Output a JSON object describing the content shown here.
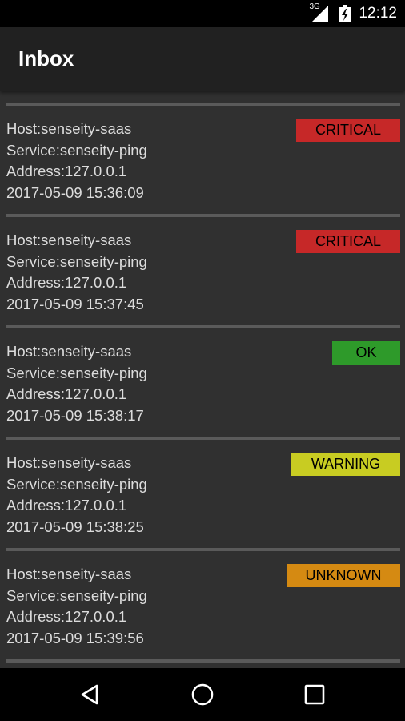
{
  "status_bar": {
    "network_label": "3G",
    "time": "12:12",
    "icons": [
      "signal-icon",
      "battery-charging-icon"
    ]
  },
  "app_bar": {
    "title": "Inbox"
  },
  "alerts": [
    {
      "host": "Host:senseity-saas",
      "service": "Service:senseity-ping",
      "address": "Address:127.0.0.1",
      "timestamp": "2017-05-09 15:36:09",
      "status": "CRITICAL",
      "status_color": "#c62828"
    },
    {
      "host": "Host:senseity-saas",
      "service": "Service:senseity-ping",
      "address": "Address:127.0.0.1",
      "timestamp": "2017-05-09 15:37:45",
      "status": "CRITICAL",
      "status_color": "#c62828"
    },
    {
      "host": "Host:senseity-saas",
      "service": "Service:senseity-ping",
      "address": "Address:127.0.0.1",
      "timestamp": "2017-05-09 15:38:17",
      "status": "OK",
      "status_color": "#2e9a2a"
    },
    {
      "host": "Host:senseity-saas",
      "service": "Service:senseity-ping",
      "address": "Address:127.0.0.1",
      "timestamp": "2017-05-09 15:38:25",
      "status": "WARNING",
      "status_color": "#c8cc22"
    },
    {
      "host": "Host:senseity-saas",
      "service": "Service:senseity-ping",
      "address": "Address:127.0.0.1",
      "timestamp": "2017-05-09 15:39:56",
      "status": "UNKNOWN",
      "status_color": "#d58a12"
    }
  ],
  "nav_bar": {
    "buttons": [
      "back-icon",
      "home-icon",
      "recents-icon"
    ]
  }
}
